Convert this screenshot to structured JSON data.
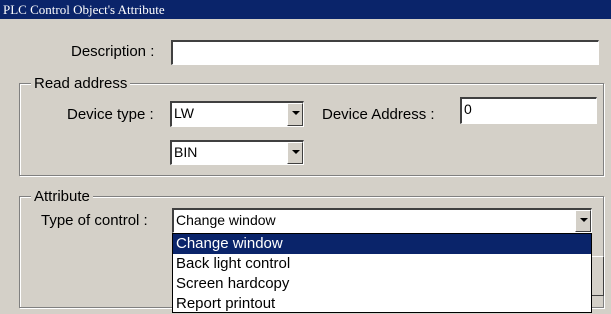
{
  "window": {
    "title": "PLC Control Object's Attribute"
  },
  "description": {
    "label": "Description :",
    "value": ""
  },
  "read_address": {
    "legend": "Read address",
    "device_type_label": "Device type :",
    "device_type_value": "LW",
    "device_address_label": "Device Address :",
    "device_address_value": "0",
    "format_value": "BIN"
  },
  "attribute": {
    "legend": "Attribute",
    "type_of_control_label": "Type of control :",
    "type_of_control_value": "Change window",
    "options": [
      "Change window",
      "Back light control",
      "Screen hardcopy",
      "Report printout"
    ],
    "selected_index": 0
  },
  "colors": {
    "title_bar": "#0a246a",
    "selection": "#0a246a",
    "dialog_bg": "#d4d0c8"
  },
  "icons": {
    "dropdown": "chevron-down-icon"
  }
}
